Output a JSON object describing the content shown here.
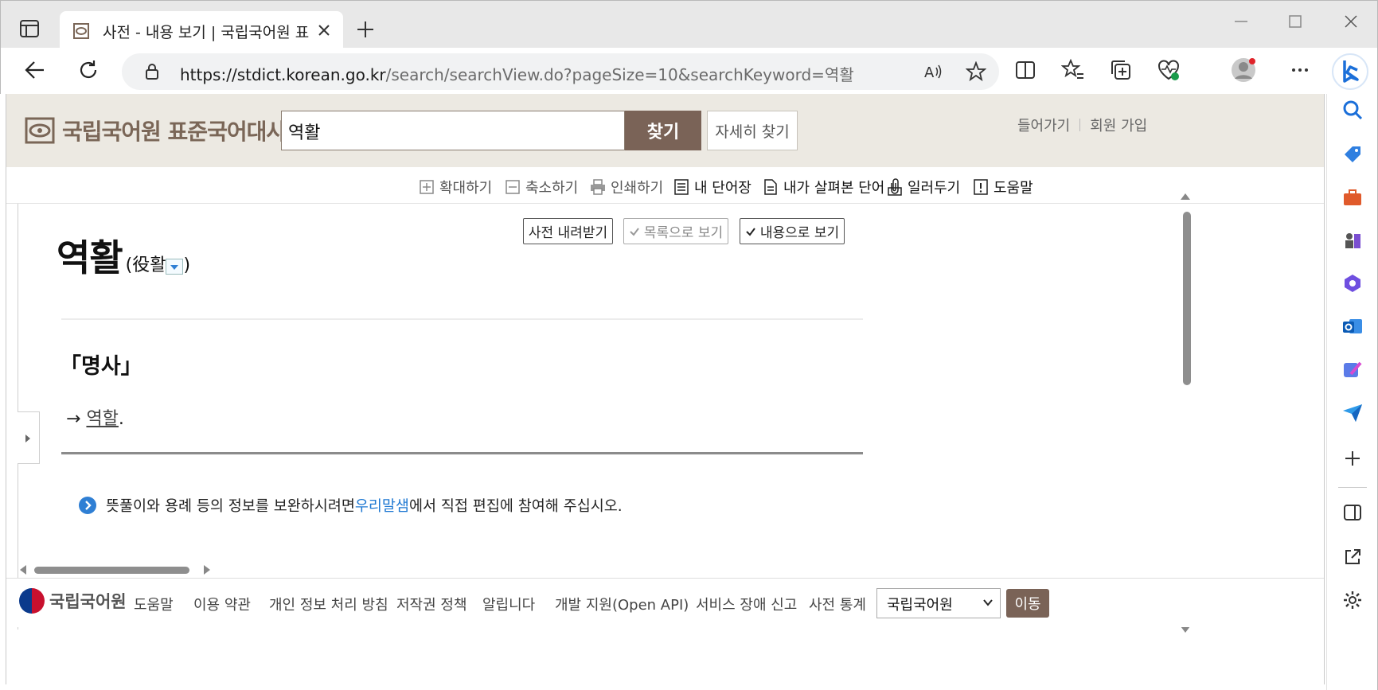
{
  "browser": {
    "tab_title": "사전 - 내용 보기 | 국립국어원 표준국어대사전",
    "url_host": "https://stdict.korean.go.kr",
    "url_path": "/search/searchView.do?pageSize=10&searchKeyword=역활"
  },
  "site": {
    "logo_text": "국립국어원 표준국어대사전",
    "search_value": "역활",
    "search_button": "찾기",
    "detail_search_button": "자세히 찾기",
    "login_link": "들어가기",
    "signup_link": "회원 가입"
  },
  "toolbar": {
    "zoom_in": "확대하기",
    "zoom_out": "축소하기",
    "print": "인쇄하기",
    "my_words": "내 단어장",
    "viewed_words": "내가 살펴본 단어",
    "report": "일러두기",
    "help": "도움말"
  },
  "entry": {
    "download_button": "사전 내려받기",
    "list_view_button": "목록으로 보기",
    "content_view_button": "내용으로 보기",
    "headword": "역활",
    "hanja": "(役활",
    "hanja_close": ")",
    "part_of_speech": "「명사」",
    "xref_arrow": "→ ",
    "xref_word": "역할",
    "xref_end": ".",
    "note_before": "뜻풀이와 용례 등의 정보를 보완하시려면 ",
    "note_link": "우리말샘",
    "note_after": "에서 직접 편집에 참여해 주십시오."
  },
  "footer": {
    "logo_text": "국립국어원",
    "links": [
      "도움말",
      "이용 약관",
      "개인 정보 처리 방침",
      "저작권 정책",
      "알립니다",
      "개발 지원(Open API)",
      "서비스 장애 신고",
      "사전 통계"
    ],
    "select_value": "국립국어원",
    "go_button": "이동"
  },
  "colors": {
    "brand_brown": "#7a6357",
    "header_bg": "#ece9e2",
    "link_blue": "#1e78d2"
  }
}
